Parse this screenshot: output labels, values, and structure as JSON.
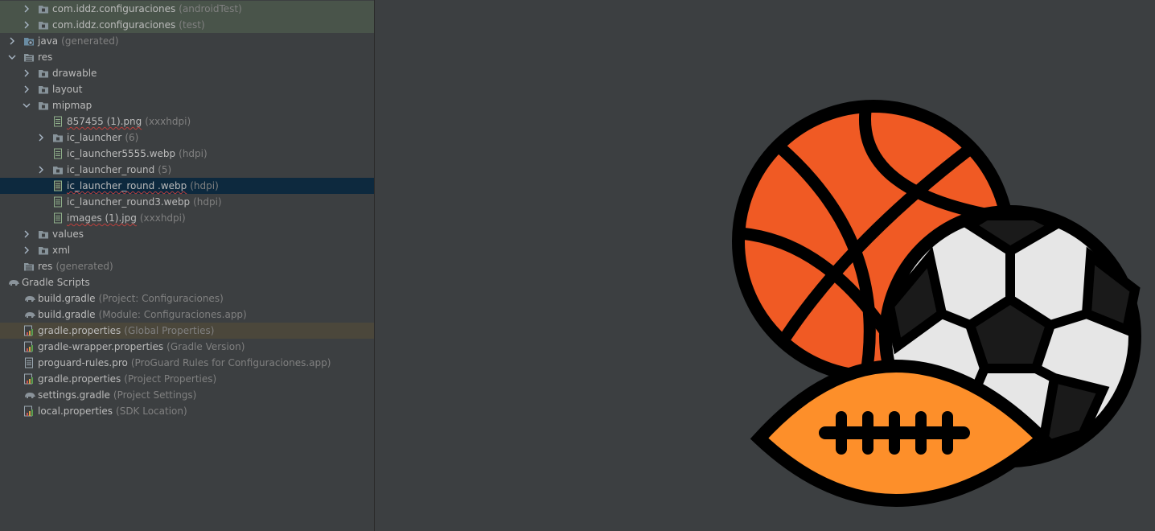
{
  "tree": [
    {
      "name": "com.iddz.configuraciones",
      "hint": "(androidTest)",
      "depth": 1,
      "expand": "collapsed",
      "icon": "folder-icon",
      "hl": "green",
      "err": false
    },
    {
      "name": "com.iddz.configuraciones",
      "hint": "(test)",
      "depth": 1,
      "expand": "collapsed",
      "icon": "folder-icon",
      "hl": "green",
      "err": false
    },
    {
      "name": "java",
      "hint": "(generated)",
      "depth": 0,
      "expand": "collapsed",
      "icon": "generated-folder-icon",
      "hl": "",
      "err": false
    },
    {
      "name": "res",
      "hint": "",
      "depth": 0,
      "expand": "expanded",
      "icon": "res-folder-icon",
      "hl": "",
      "err": false
    },
    {
      "name": "drawable",
      "hint": "",
      "depth": 1,
      "expand": "collapsed",
      "icon": "folder-icon",
      "hl": "",
      "err": false
    },
    {
      "name": "layout",
      "hint": "",
      "depth": 1,
      "expand": "collapsed",
      "icon": "folder-icon",
      "hl": "",
      "err": false
    },
    {
      "name": "mipmap",
      "hint": "",
      "depth": 1,
      "expand": "expanded",
      "icon": "folder-icon",
      "hl": "",
      "err": false
    },
    {
      "name": "857455 (1).png",
      "hint": "(xxxhdpi)",
      "depth": 2,
      "expand": "none",
      "icon": "image-file-icon",
      "hl": "",
      "err": true
    },
    {
      "name": "ic_launcher",
      "hint": "(6)",
      "depth": 2,
      "expand": "collapsed",
      "icon": "folder-icon",
      "hl": "",
      "err": false
    },
    {
      "name": "ic_launcher5555.webp",
      "hint": "(hdpi)",
      "depth": 2,
      "expand": "none",
      "icon": "image-file-icon",
      "hl": "",
      "err": false
    },
    {
      "name": "ic_launcher_round",
      "hint": "(5)",
      "depth": 2,
      "expand": "collapsed",
      "icon": "folder-icon",
      "hl": "",
      "err": false
    },
    {
      "name": "ic_launcher_round .webp",
      "hint": "(hdpi)",
      "depth": 2,
      "expand": "none",
      "icon": "image-file-icon",
      "hl": "selected",
      "err": true
    },
    {
      "name": "ic_launcher_round3.webp",
      "hint": "(hdpi)",
      "depth": 2,
      "expand": "none",
      "icon": "image-file-icon",
      "hl": "",
      "err": false
    },
    {
      "name": "images (1).jpg",
      "hint": "(xxxhdpi)",
      "depth": 2,
      "expand": "none",
      "icon": "image-file-icon",
      "hl": "",
      "err": true
    },
    {
      "name": "values",
      "hint": "",
      "depth": 1,
      "expand": "collapsed",
      "icon": "folder-icon",
      "hl": "",
      "err": false
    },
    {
      "name": "xml",
      "hint": "",
      "depth": 1,
      "expand": "collapsed",
      "icon": "folder-icon",
      "hl": "",
      "err": false
    },
    {
      "name": "res",
      "hint": "(generated)",
      "depth": 0,
      "expand": "none",
      "icon": "res-folder-icon",
      "hl": "",
      "err": false
    },
    {
      "name": "Gradle Scripts",
      "hint": "",
      "depth": -1,
      "expand": "expanded",
      "icon": "gradle-elephant-icon",
      "hl": "",
      "err": false
    },
    {
      "name": "build.gradle",
      "hint": "(Project: Configuraciones)",
      "depth": 0,
      "expand": "none",
      "icon": "gradle-elephant-icon",
      "hl": "",
      "err": false
    },
    {
      "name": "build.gradle",
      "hint": "(Module: Configuraciones.app)",
      "depth": 0,
      "expand": "none",
      "icon": "gradle-elephant-icon",
      "hl": "",
      "err": false
    },
    {
      "name": "gradle.properties",
      "hint": "(Global Properties)",
      "depth": 0,
      "expand": "none",
      "icon": "properties-file-icon",
      "hl": "yellow",
      "err": false
    },
    {
      "name": "gradle-wrapper.properties",
      "hint": "(Gradle Version)",
      "depth": 0,
      "expand": "none",
      "icon": "properties-file-icon",
      "hl": "",
      "err": false
    },
    {
      "name": "proguard-rules.pro",
      "hint": "(ProGuard Rules for Configuraciones.app)",
      "depth": 0,
      "expand": "none",
      "icon": "text-file-icon",
      "hl": "",
      "err": false
    },
    {
      "name": "gradle.properties",
      "hint": "(Project Properties)",
      "depth": 0,
      "expand": "none",
      "icon": "properties-file-icon",
      "hl": "",
      "err": false
    },
    {
      "name": "settings.gradle",
      "hint": "(Project Settings)",
      "depth": 0,
      "expand": "none",
      "icon": "gradle-elephant-icon",
      "hl": "",
      "err": false
    },
    {
      "name": "local.properties",
      "hint": "(SDK Location)",
      "depth": 0,
      "expand": "none",
      "icon": "properties-file-icon",
      "hl": "",
      "err": false
    }
  ],
  "preview": {
    "subject": "sports-balls-image",
    "colors": {
      "basketball": "#f05a24",
      "football": "#fd8f2a",
      "soccer_white": "#e6e6e6",
      "soccer_dark": "#1a1a1a",
      "outline": "#000000"
    }
  }
}
